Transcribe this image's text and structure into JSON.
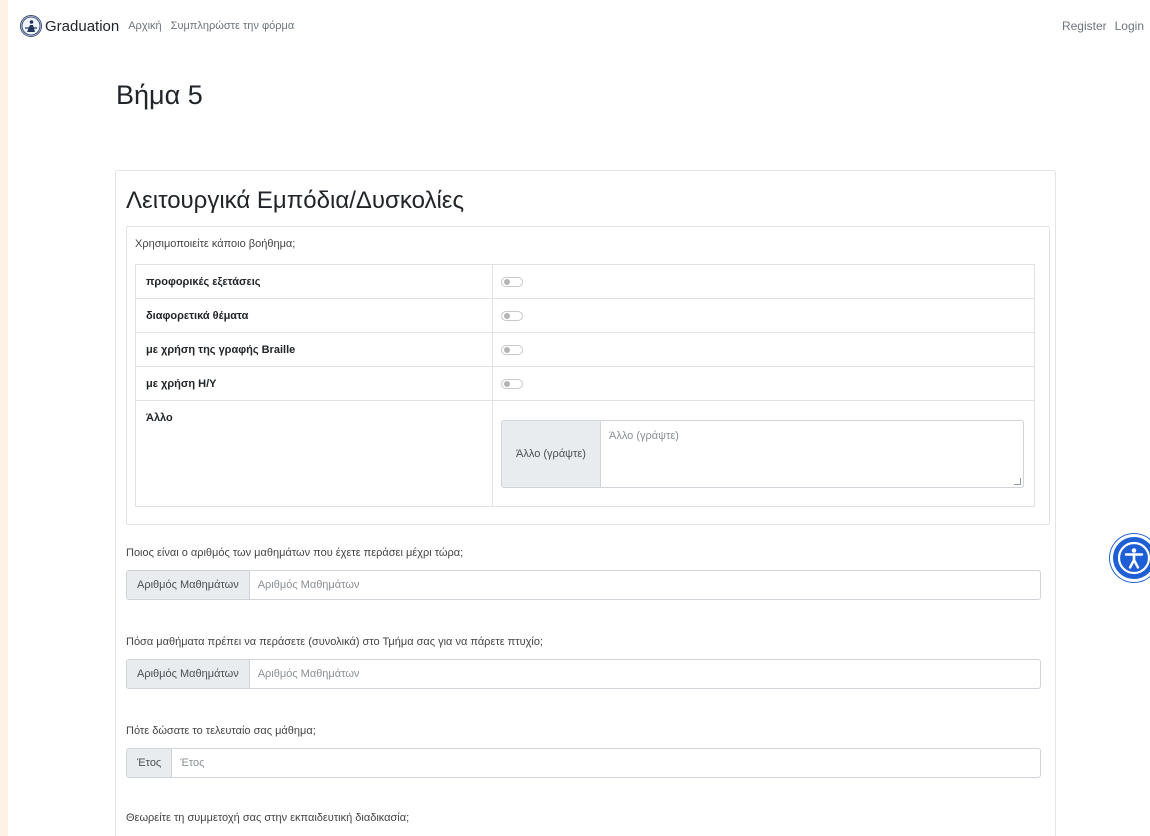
{
  "navbar": {
    "brand": "Graduation",
    "links": [
      "Αρχική",
      "Συμπληρώστε την φόρμα"
    ],
    "register": "Register",
    "login": "Login"
  },
  "page_title": "Βήμα 5",
  "section": {
    "title": "Λειτουργικά Εμπόδια/Δυσκολίες",
    "aid_question": "Χρησιμοποιείτε κάποιο βοήθημα;",
    "aids": [
      {
        "label": "προφορικές εξετάσεις",
        "enabled": false
      },
      {
        "label": "διαφορετικά θέματα",
        "enabled": false
      },
      {
        "label": "με χρήση της γραφής Braille",
        "enabled": false
      },
      {
        "label": "με χρήση Η/Υ",
        "enabled": false
      }
    ],
    "other": {
      "label": "Άλλο",
      "prefix": "Άλλο (γράψτε)",
      "placeholder": "Άλλο (γράψτε)"
    },
    "questions": [
      {
        "label": "Ποιος είναι ο αριθμός των μαθημάτων που έχετε περάσει μέχρι τώρα;",
        "prefix": "Αριθμός Μαθημάτων",
        "placeholder": "Αριθμός Μαθημάτων"
      },
      {
        "label": "Πόσα μαθήματα πρέπει να περάσετε (συνολικά) στο Τμήμα σας για να πάρετε πτυχίο;",
        "prefix": "Αριθμός Μαθημάτων",
        "placeholder": "Αριθμός Μαθημάτων"
      },
      {
        "label": "Πότε δώσατε το τελευταίο σας μάθημα;",
        "prefix": "Έτος",
        "placeholder": "Έτος"
      },
      {
        "label": "Θεωρείτε τη συμμετοχή σας στην εκπαιδευτική διαδικασία;"
      }
    ]
  },
  "colors": {
    "side_background": "#fdf2e4",
    "accessibility_button": "#1f5fd6"
  }
}
